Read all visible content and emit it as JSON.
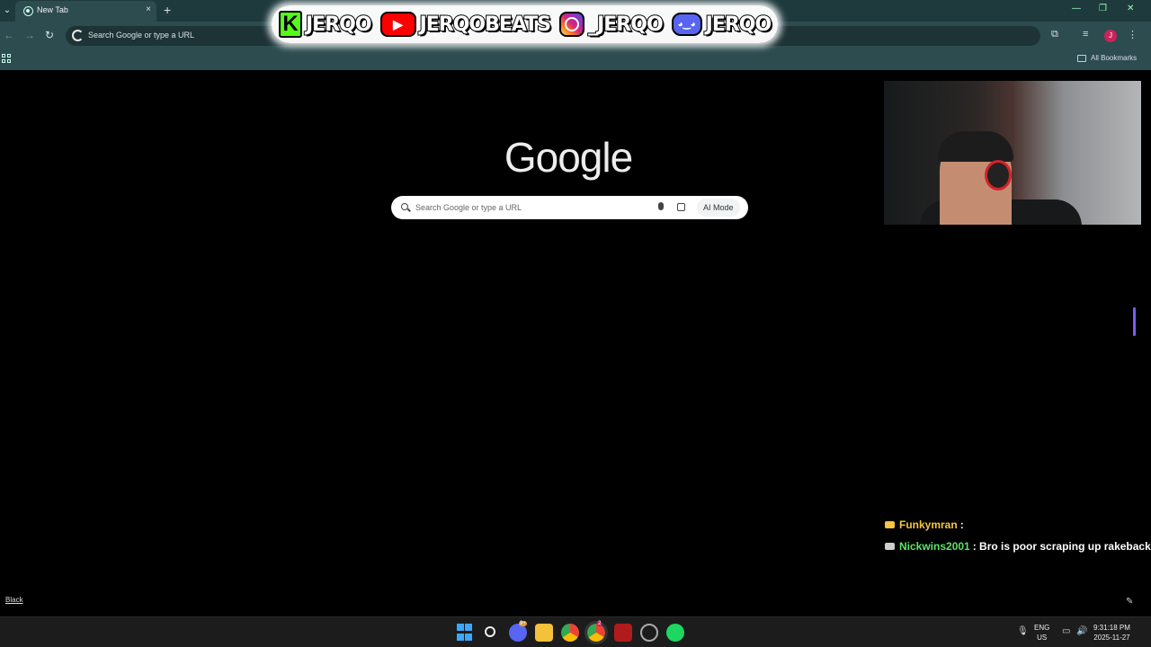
{
  "browser": {
    "tab_title": "New Tab",
    "tab_close": "×",
    "new_tab": "+",
    "omnibox_placeholder": "Search Google or type a URL",
    "profile_initial": "J",
    "bookmarks_label": "All Bookmarks"
  },
  "banner": {
    "kick_letter": "K",
    "kick": "JERQO",
    "youtube": "JERQOBEATS",
    "instagram": "_JERQO",
    "discord": "JERQO"
  },
  "page": {
    "logo": "Google",
    "search_placeholder": "Search Google or type a URL",
    "ai_mode": "AI Mode",
    "theme_label": "Black"
  },
  "chat": [
    {
      "user": "Funkymran",
      "message": ":",
      "user_color": "#f5c542",
      "badge_color": "#f5c542"
    },
    {
      "user": "Nickwins2001",
      "message": ": Bro is poor scraping up rakeback",
      "user_color": "#5fe06a",
      "badge_color": "#cfcfcf"
    }
  ],
  "taskbar": {
    "lang_top": "ENG",
    "lang_bottom": "US",
    "time": "9:31:18 PM",
    "date": "2025-11-27",
    "discord_badge": "9+",
    "chrome_badge": "2"
  },
  "colors": {
    "accent": "#7b5cff",
    "chrome_frame": "#2c4c50"
  }
}
